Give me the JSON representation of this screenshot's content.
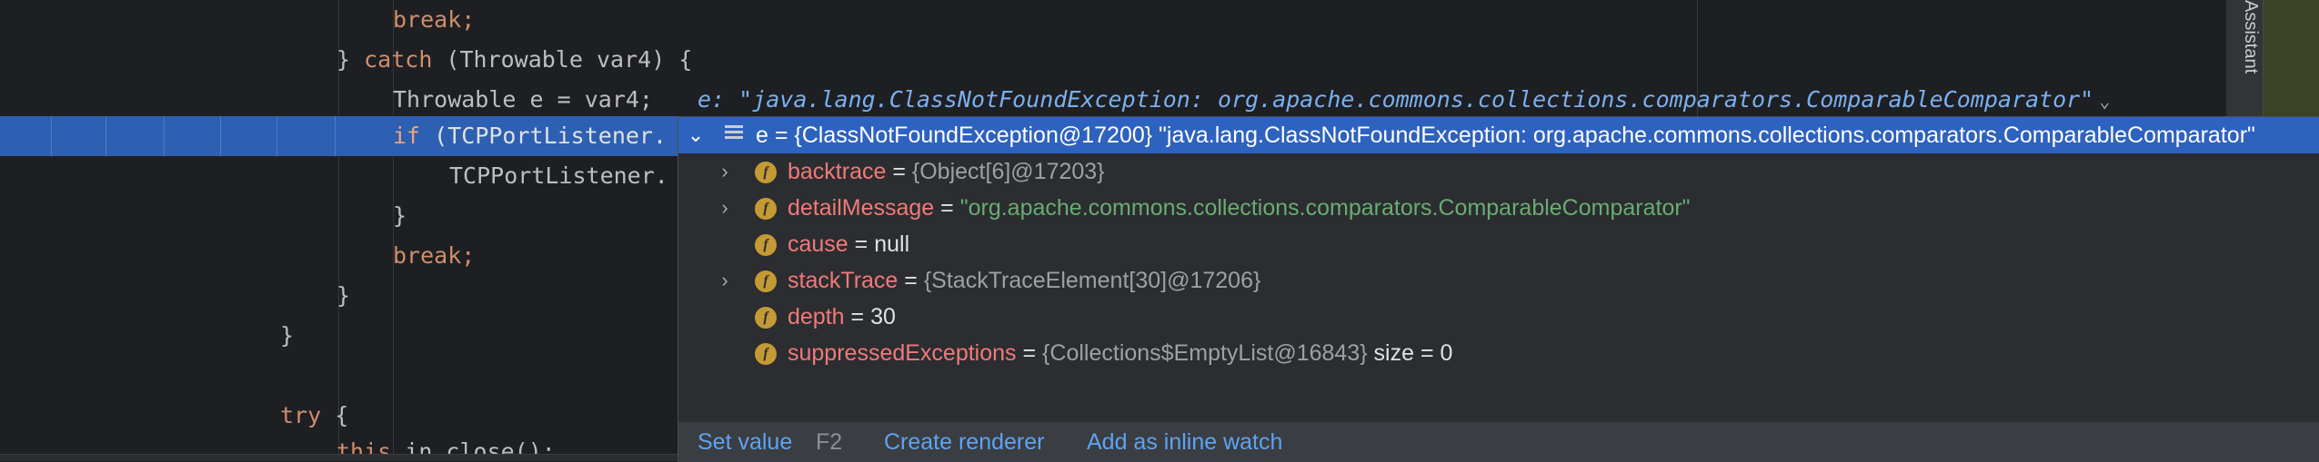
{
  "editor": {
    "lines": [
      {
        "id": "break1",
        "segments": [
          {
            "text": "break;",
            "kind": "kw"
          }
        ]
      },
      {
        "id": "catch",
        "segments": [
          {
            "text": "} ",
            "kind": "plain"
          },
          {
            "text": "catch",
            "kind": "kw"
          },
          {
            "text": " (Throwable var4) {",
            "kind": "plain"
          }
        ]
      },
      {
        "id": "throwable",
        "segments": [
          {
            "text": "Throwable e = var4;",
            "kind": "plain"
          }
        ]
      },
      {
        "id": "if",
        "segments": [
          {
            "text": "if",
            "kind": "kw"
          },
          {
            "text": " (TCPPortListener.",
            "kind": "plain"
          }
        ]
      },
      {
        "id": "tcp",
        "segments": [
          {
            "text": "TCPPortListener.",
            "kind": "plain"
          }
        ]
      },
      {
        "id": "brace1",
        "segments": [
          {
            "text": "}",
            "kind": "plain"
          }
        ]
      },
      {
        "id": "break2",
        "segments": [
          {
            "text": "break;",
            "kind": "kw"
          }
        ]
      },
      {
        "id": "brace2",
        "segments": [
          {
            "text": "}",
            "kind": "plain"
          }
        ]
      },
      {
        "id": "brace3",
        "segments": [
          {
            "text": "}",
            "kind": "plain"
          }
        ]
      },
      {
        "id": "blank",
        "segments": []
      },
      {
        "id": "try",
        "segments": [
          {
            "text": "try",
            "kind": "kw"
          },
          {
            "text": " {",
            "kind": "plain"
          }
        ]
      },
      {
        "id": "close",
        "segments": [
          {
            "text": "this",
            "kind": "kw"
          },
          {
            "text": ".in.close();",
            "kind": "plain"
          }
        ]
      }
    ],
    "inline_debug": "e: \"java.lang.ClassNotFoundException: org.apache.commons.collections.comparators.ComparableComparator\"",
    "execution_line": "if"
  },
  "debug_popup": {
    "root": {
      "name": "e",
      "eq": " = ",
      "type": "{ClassNotFoundException@17200}",
      "value": " \"java.lang.ClassNotFoundException: org.apache.commons.collections.comparators.ComparableComparator\""
    },
    "fields": [
      {
        "name": "backtrace",
        "eq": " = ",
        "type_value": "{Object[6]@17203}",
        "string_value": "",
        "plain_value": "",
        "expandable": true
      },
      {
        "name": "detailMessage",
        "eq": " = ",
        "type_value": "",
        "string_value": "\"org.apache.commons.collections.comparators.ComparableComparator\"",
        "plain_value": "",
        "expandable": true
      },
      {
        "name": "cause",
        "eq": " = ",
        "type_value": "",
        "string_value": "",
        "plain_value": "null",
        "expandable": false
      },
      {
        "name": "stackTrace",
        "eq": " = ",
        "type_value": "{StackTraceElement[30]@17206}",
        "string_value": "",
        "plain_value": "",
        "expandable": true
      },
      {
        "name": "depth",
        "eq": " = ",
        "type_value": "",
        "string_value": "",
        "plain_value": "30",
        "expandable": false
      },
      {
        "name": "suppressedExceptions",
        "eq": " = ",
        "type_value": "{Collections$EmptyList@16843}",
        "string_value": "",
        "plain_value": "  size = 0",
        "expandable": false
      }
    ],
    "field_icon_letter": "f",
    "hints": {
      "set_value": "Set value",
      "set_value_key": "F2",
      "create_renderer": "Create renderer",
      "add_inline_watch": "Add as inline watch"
    }
  },
  "assistant_tab": {
    "label": "Assistant"
  },
  "icons": {
    "expand": "chevron-right-icon",
    "collapse": "chevron-down-icon",
    "object": "object-lines-icon",
    "field": "field-icon"
  },
  "colors": {
    "editor_bg": "#1e1f22",
    "keyword": "#cf8e6d",
    "selection": "#2e62bf",
    "field_name": "#f07a7a",
    "string_value": "#6aab73",
    "link": "#5da3f5",
    "inline_debug": "#7ab0ef"
  }
}
